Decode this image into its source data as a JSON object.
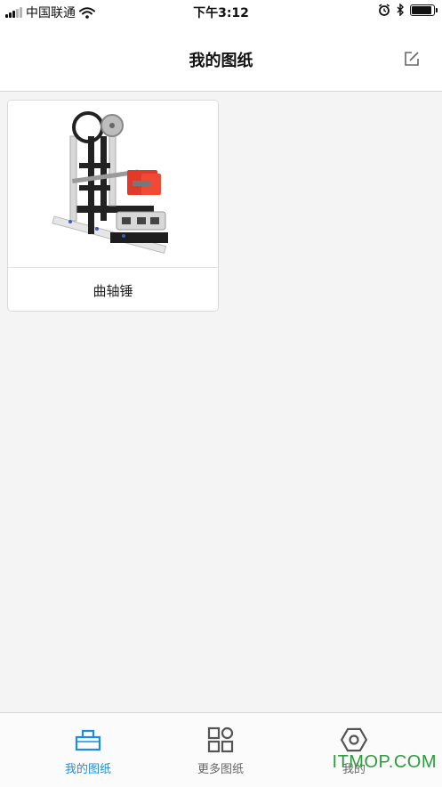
{
  "status_bar": {
    "carrier": "中国联通",
    "time": "下午3:12"
  },
  "nav": {
    "title": "我的图纸",
    "edit_icon": "edit-square-icon"
  },
  "cards": [
    {
      "title": "曲轴锤"
    }
  ],
  "tabs": [
    {
      "label": "我的图纸",
      "icon": "box-icon",
      "active": true
    },
    {
      "label": "更多图纸",
      "icon": "grid-icon",
      "active": false
    },
    {
      "label": "我的",
      "icon": "hex-nut-icon",
      "active": false
    }
  ],
  "watermark": "ITMOP.COM",
  "colors": {
    "accent": "#1a8fe0",
    "tab_inactive": "#666666",
    "watermark": "#2a9d3c"
  }
}
